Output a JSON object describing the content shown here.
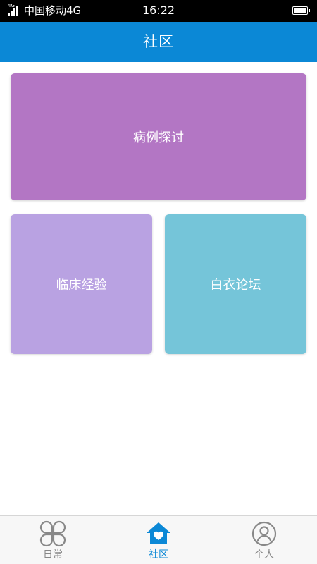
{
  "status_bar": {
    "network_type": "4G",
    "carrier": "中国移动4G",
    "time": "16:22"
  },
  "header": {
    "title": "社区"
  },
  "cards": [
    {
      "label": "病例探讨",
      "color": "#b376c4"
    },
    {
      "label": "临床经验",
      "color": "#b9a2e2"
    },
    {
      "label": "白衣论坛",
      "color": "#75c5d9"
    }
  ],
  "bottom_nav": {
    "active_index": 1,
    "active_color": "#0b88d6",
    "inactive_color": "#888888",
    "items": [
      {
        "label": "日常",
        "icon": "clover-icon"
      },
      {
        "label": "社区",
        "icon": "home-heart-icon"
      },
      {
        "label": "个人",
        "icon": "user-circle-icon"
      }
    ]
  }
}
